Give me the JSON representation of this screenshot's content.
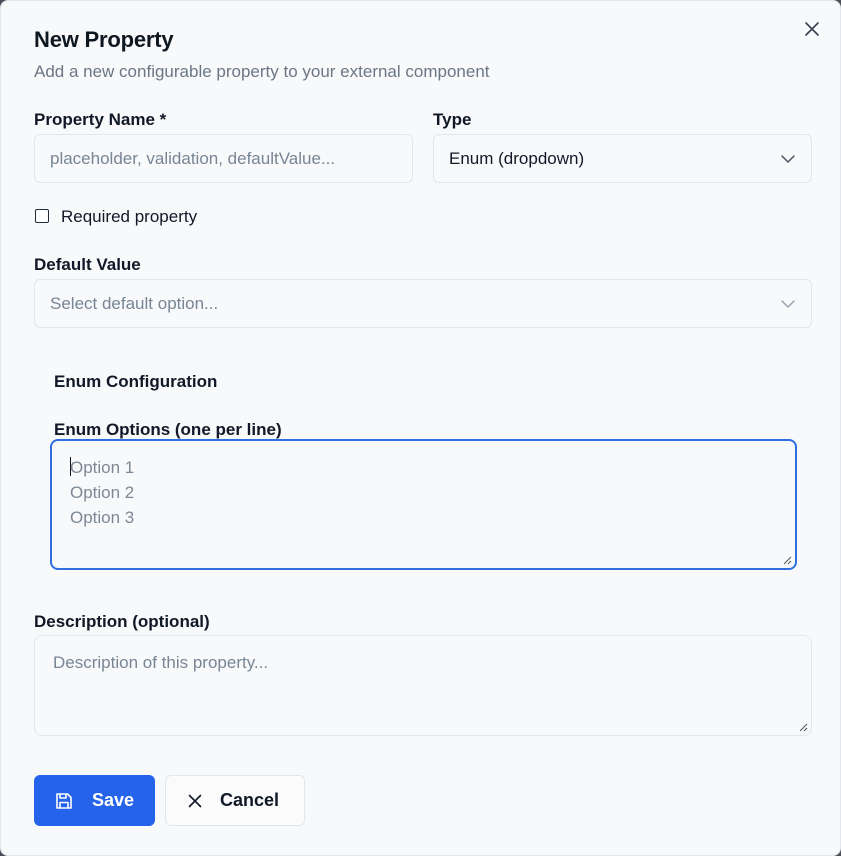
{
  "dialog": {
    "title": "New Property",
    "subtitle": "Add a new configurable property to your external component",
    "close_icon": "close-icon"
  },
  "form": {
    "property_name": {
      "label": "Property Name *",
      "value": "",
      "placeholder": "placeholder, validation, defaultValue..."
    },
    "type": {
      "label": "Type",
      "selected": "Enum (dropdown)"
    },
    "required": {
      "label": "Required property",
      "checked": false
    },
    "default_value": {
      "label": "Default Value",
      "placeholder": "Select default option..."
    },
    "enum_section": {
      "title": "Enum Configuration",
      "options_label": "Enum Options (one per line)",
      "placeholder_lines": [
        "Option 1",
        "Option 2",
        "Option 3"
      ]
    },
    "description": {
      "label": "Description (optional)",
      "placeholder": "Description of this property..."
    }
  },
  "buttons": {
    "save": {
      "label": "Save",
      "icon": "save-icon"
    },
    "cancel": {
      "label": "Cancel",
      "icon": "close-icon"
    }
  },
  "colors": {
    "primary": "#2563eb",
    "focus_border": "#2f6fe0",
    "placeholder": "#788595",
    "background": "#f8f9fa"
  }
}
